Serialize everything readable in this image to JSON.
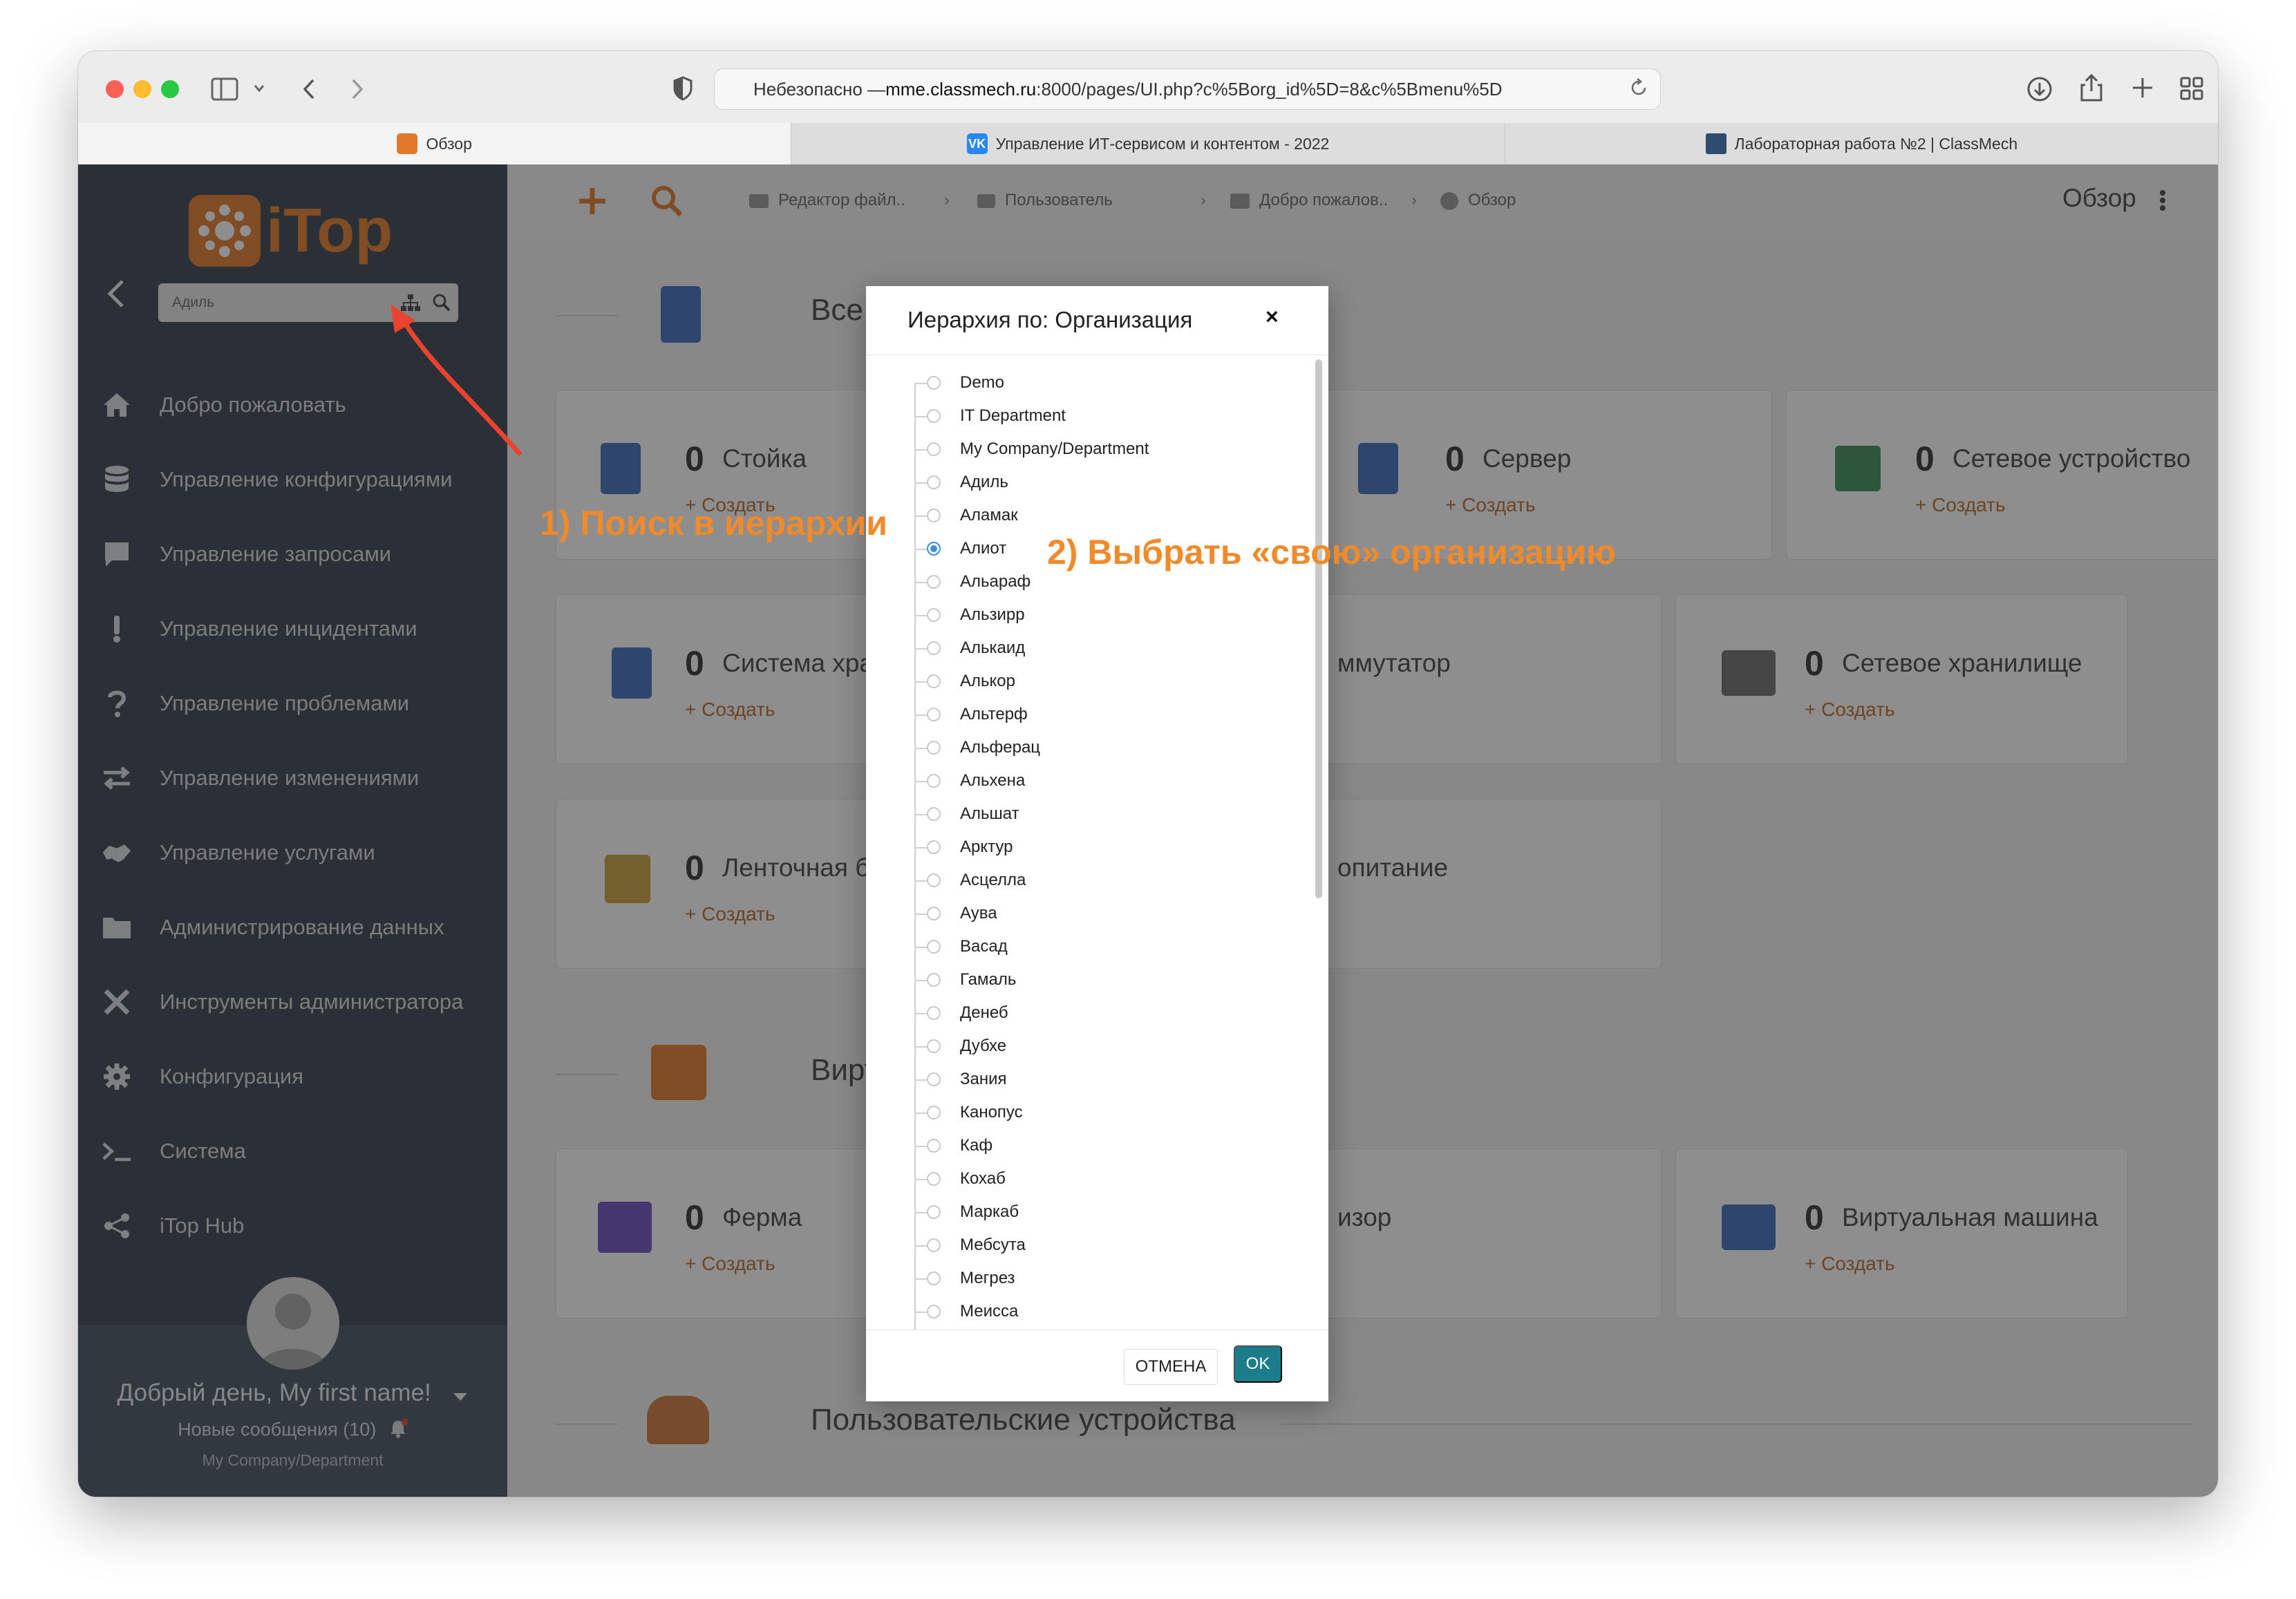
{
  "browser": {
    "url_prefix": "Небезопасно — ",
    "url_host": "mme.classmech.ru",
    "url_path": ":8000/pages/UI.php?c%5Borg_id%5D=8&c%5Bmenu%5D",
    "tabs": [
      {
        "label": "Обзор"
      },
      {
        "label": "Управление ИТ-сервисом и контентом - 2022"
      },
      {
        "label": "Лабораторная работа №2 | ClassMech"
      }
    ]
  },
  "sidebar": {
    "logo_text": "iTop",
    "search_value": "Адиль",
    "items": [
      {
        "label": "Добро пожаловать",
        "icon": "home-icon"
      },
      {
        "label": "Управление конфигурациями",
        "icon": "database-icon"
      },
      {
        "label": "Управление запросами",
        "icon": "chat-icon"
      },
      {
        "label": "Управление инцидентами",
        "icon": "exclamation-icon"
      },
      {
        "label": "Управление проблемами",
        "icon": "question-icon"
      },
      {
        "label": "Управление изменениями",
        "icon": "arrows-icon"
      },
      {
        "label": "Управление услугами",
        "icon": "handshake-icon"
      },
      {
        "label": "Администрирование данных",
        "icon": "folder-icon"
      },
      {
        "label": "Инструменты администратора",
        "icon": "tools-icon"
      },
      {
        "label": "Конфигурация",
        "icon": "gear-icon"
      },
      {
        "label": "Система",
        "icon": "terminal-icon"
      },
      {
        "label": "iTop Hub",
        "icon": "share-icon"
      }
    ],
    "greeting": "Добрый день, My first name!",
    "messages": "Новые сообщения (10)",
    "org": "My Company/Department"
  },
  "topbar": {
    "breadcrumbs": [
      "Редактор файл..",
      "Пользователь",
      "Добро пожалов..",
      "Обзор"
    ],
    "page_title": "Обзор"
  },
  "main": {
    "sections": [
      {
        "title": "Все устр"
      },
      {
        "title": "Виртуали"
      },
      {
        "title": "Пользовательские устройства"
      }
    ],
    "cards": [
      {
        "count": "0",
        "name": "Стойка",
        "action": "Создать"
      },
      {
        "count": "0",
        "name": "Сервер",
        "action": "Создать"
      },
      {
        "count": "0",
        "name": "Сетевое устройство",
        "action": "Создать"
      },
      {
        "count": "0",
        "name": "Система хра",
        "action": "Создать"
      },
      {
        "count": "",
        "name": "ммутатор",
        "action": ""
      },
      {
        "count": "0",
        "name": "Сетевое хранилище",
        "action": "Создать"
      },
      {
        "count": "0",
        "name": "Ленточная б",
        "action": "Создать"
      },
      {
        "count": "",
        "name": "опитание",
        "action": ""
      },
      {
        "count": "0",
        "name": "Ферма",
        "action": "Создать"
      },
      {
        "count": "",
        "name": "изор",
        "action": ""
      },
      {
        "count": "0",
        "name": "Виртуальная машина",
        "action": "Создать"
      }
    ]
  },
  "modal": {
    "title": "Иерархия по: Организация",
    "close": "×",
    "options": [
      "Demo",
      "IT Department",
      "My Company/Department",
      "Адиль",
      "Аламак",
      "Алиот",
      "Альараф",
      "Альзирр",
      "Алькаид",
      "Алькор",
      "Альтерф",
      "Альферац",
      "Альхена",
      "Альшат",
      "Арктур",
      "Асцелла",
      "Аува",
      "Васад",
      "Гамаль",
      "Денеб",
      "Дубхе",
      "Зания",
      "Канопус",
      "Каф",
      "Кохаб",
      "Маркаб",
      "Мебсута",
      "Мегрез",
      "Меисса"
    ],
    "selected": "Алиот",
    "cancel_label": "ОТМЕНА",
    "ok_label": "OK"
  },
  "annotations": {
    "step1": "1) Поиск в иерархии",
    "step2": "2) Выбрать «свою» организацию"
  },
  "colors": {
    "sidebar_bg": "#36434f",
    "accent_orange": "#f08a2a",
    "ok_button": "#1c7d8a",
    "radio_selected": "#3d8fd6",
    "arrow_red": "#e8432e"
  }
}
